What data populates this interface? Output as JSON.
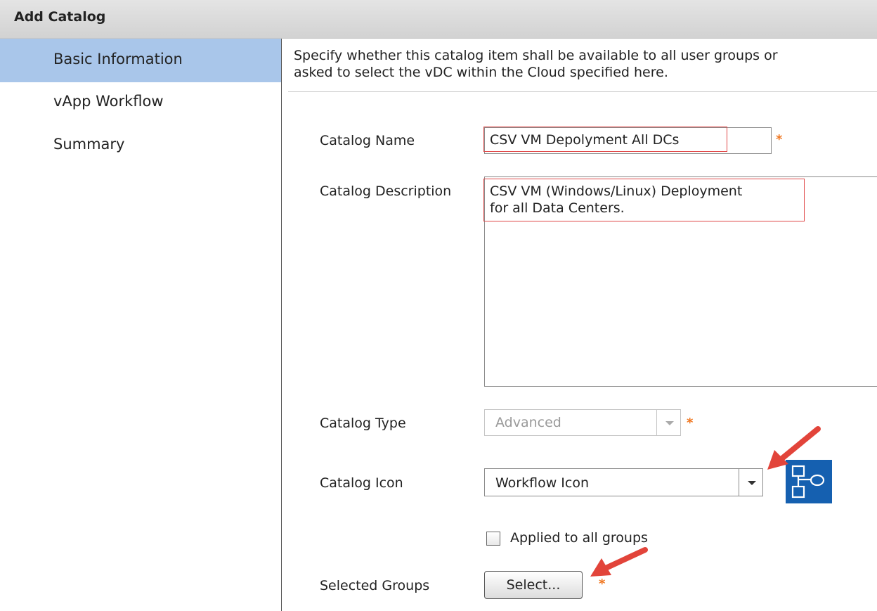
{
  "window": {
    "title": "Add Catalog"
  },
  "nav": {
    "items": [
      {
        "label": "Basic Information"
      },
      {
        "label": "vApp Workflow"
      },
      {
        "label": "Summary"
      }
    ]
  },
  "instructions": {
    "line1": "Specify whether this catalog item shall be available to all user groups or",
    "line2": "asked to select the vDC within the Cloud specified here."
  },
  "form": {
    "catalog_name": {
      "label": "Catalog Name",
      "value": "CSV VM Depolyment All DCs",
      "required": "*"
    },
    "catalog_description": {
      "label": "Catalog Description",
      "line1": "CSV VM (Windows/Linux) Deployment",
      "line2": "for all Data Centers."
    },
    "catalog_type": {
      "label": "Catalog Type",
      "value": "Advanced",
      "required": "*"
    },
    "catalog_icon": {
      "label": "Catalog Icon",
      "value": "Workflow Icon",
      "icon_name": "workflow-icon"
    },
    "applied_to_all": {
      "label": "Applied to all groups",
      "checked": false
    },
    "selected_groups": {
      "label": "Selected Groups",
      "button_label": "Select...",
      "required": "*"
    }
  },
  "colors": {
    "nav_active": "#a9c6ea",
    "required": "#f0761f",
    "highlight_box": "#e04848",
    "annotation_arrow": "#e2443a",
    "icon_bg": "#1560b0"
  }
}
